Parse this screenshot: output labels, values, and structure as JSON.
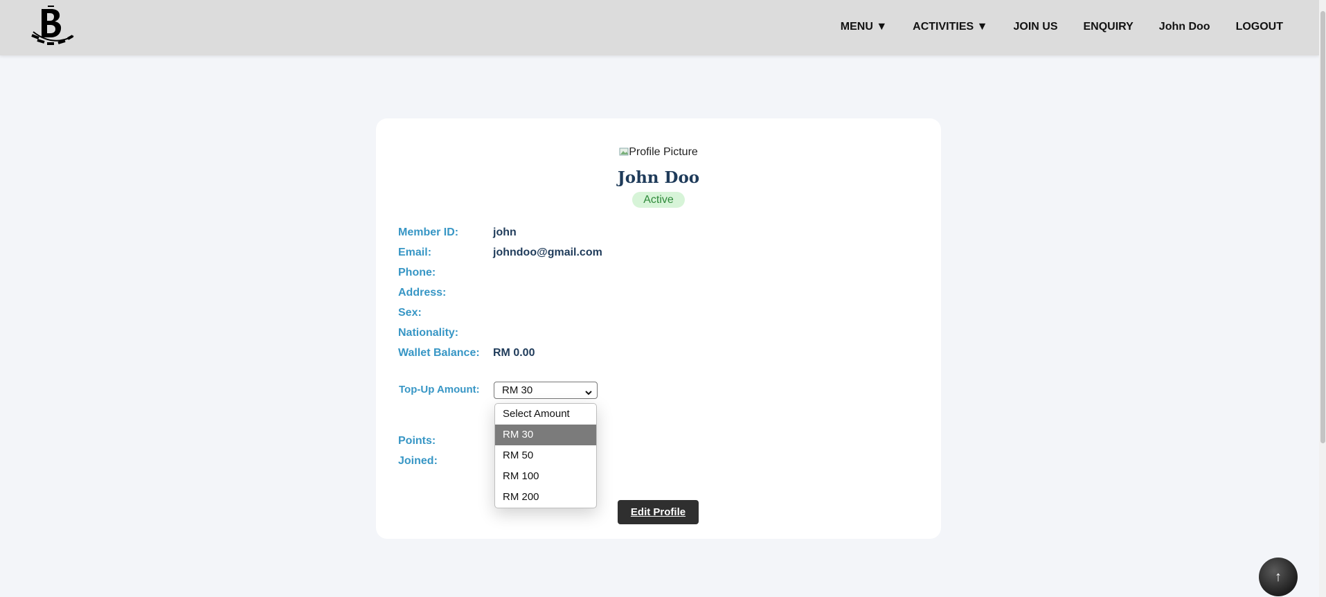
{
  "header": {
    "nav": [
      "MENU ▼",
      "ACTIVITIES ▼",
      "JOIN US",
      "ENQUIRY",
      "John Doo",
      "LOGOUT"
    ]
  },
  "profile": {
    "avatar_alt": "Profile Picture",
    "name": "John Doo",
    "status": "Active",
    "fields": [
      {
        "label": "Member ID:",
        "value": "john"
      },
      {
        "label": "Email:",
        "value": "johndoo@gmail.com"
      },
      {
        "label": "Phone:",
        "value": ""
      },
      {
        "label": "Address:",
        "value": ""
      },
      {
        "label": "Sex:",
        "value": ""
      },
      {
        "label": "Nationality:",
        "value": ""
      },
      {
        "label": "Wallet Balance:",
        "value": "RM 0.00"
      }
    ],
    "topup": {
      "label": "Top-Up Amount:",
      "selected": "RM 30",
      "options": [
        "Select Amount",
        "RM 30",
        "RM 50",
        "RM 100",
        "RM 200"
      ]
    },
    "points_label": "Points:",
    "joined_label": "Joined:",
    "edit_button": "Edit Profile"
  },
  "scroll_top_icon": "↑",
  "colors": {
    "header_bg": "#dcdcdc",
    "page_bg": "#f3f5f9",
    "label": "#3796c5",
    "value": "#1f3b5a",
    "badge_bg": "#d7f4d8",
    "badge_text": "#2e8a3a",
    "button_bg": "#2f2f2f"
  }
}
